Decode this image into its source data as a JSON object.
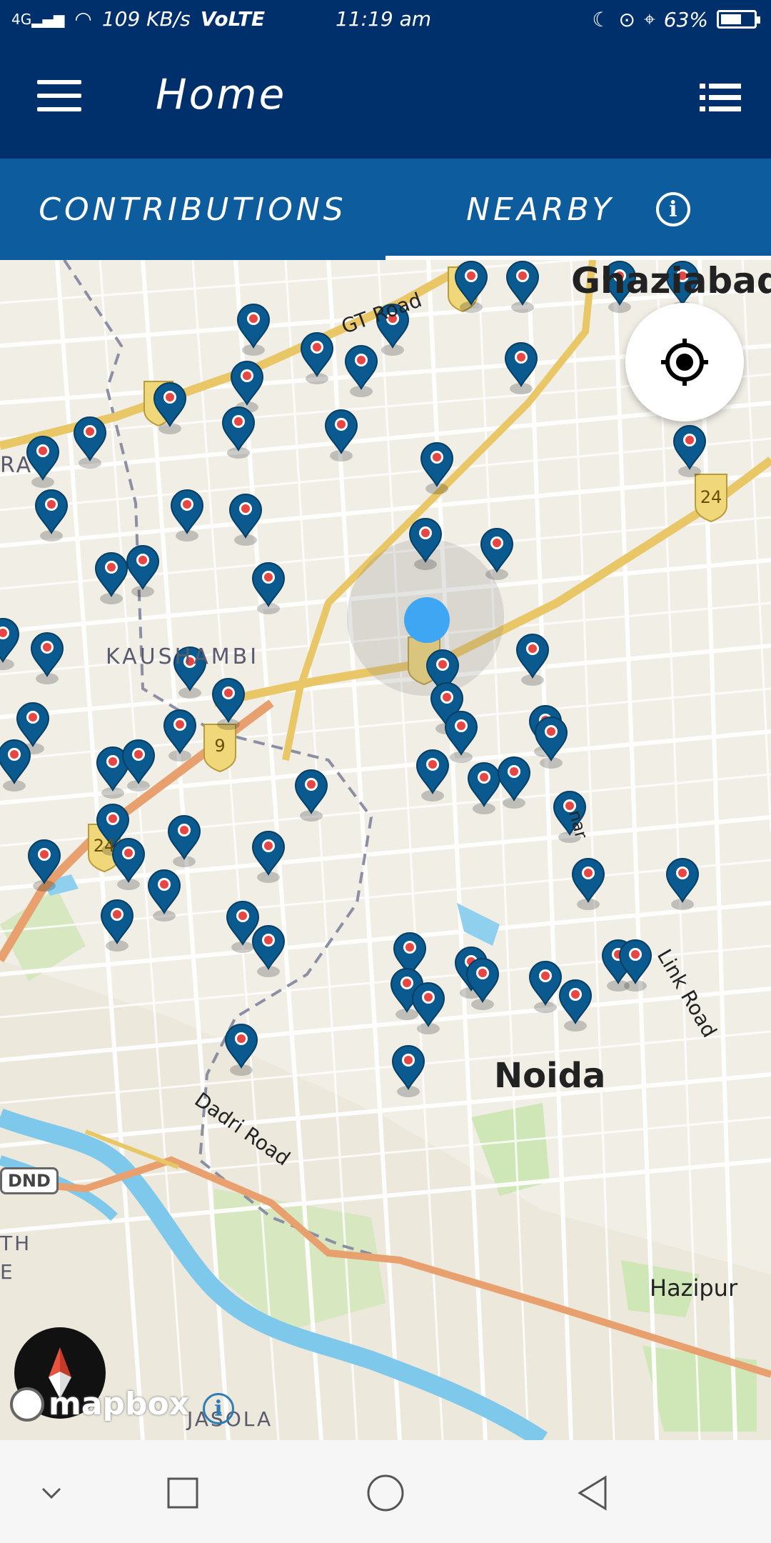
{
  "status_bar": {
    "network": "4G",
    "speed": "109 KB/s",
    "volte": "VoLTE",
    "time": "11:19 am",
    "battery": "63%",
    "battery_level": 0.63
  },
  "app_bar": {
    "title": "Home",
    "menu_icon": "hamburger-icon",
    "list_icon": "list-icon"
  },
  "tabs": [
    {
      "label": "CONTRIBUTIONS",
      "selected": false
    },
    {
      "label": "NEARBY",
      "selected": true,
      "icon": "info-icon"
    }
  ],
  "map": {
    "labels": {
      "ghaziabad": "Ghaziabad",
      "kaushambi": "KAUSHAMBI",
      "noida": "Noida",
      "hazipur": "Hazipur",
      "jasola": "JASOLA",
      "gt_road": "GT Road",
      "dadri_road": "Dadri Road",
      "link_road": "Link Road",
      "ra": "RA",
      "th": "TH",
      "e": "E",
      "nar": "nar"
    },
    "shields": {
      "nh9": "9",
      "nh24": "24",
      "dnd": "DND"
    },
    "attribution": "mapbox",
    "attribution_info": "i"
  },
  "controls": {
    "locate_icon": "my-location-icon",
    "compass_icon": "compass-icon"
  },
  "nav_bar": {
    "items": [
      "chevron-down-icon",
      "recents-icon",
      "home-icon",
      "back-icon"
    ]
  },
  "colors": {
    "appbar": "#00306b",
    "tabbar": "#0d5c9d",
    "pin": "#0a5a8f",
    "pin_center": "#e84545",
    "user_location": "#2196f3"
  }
}
